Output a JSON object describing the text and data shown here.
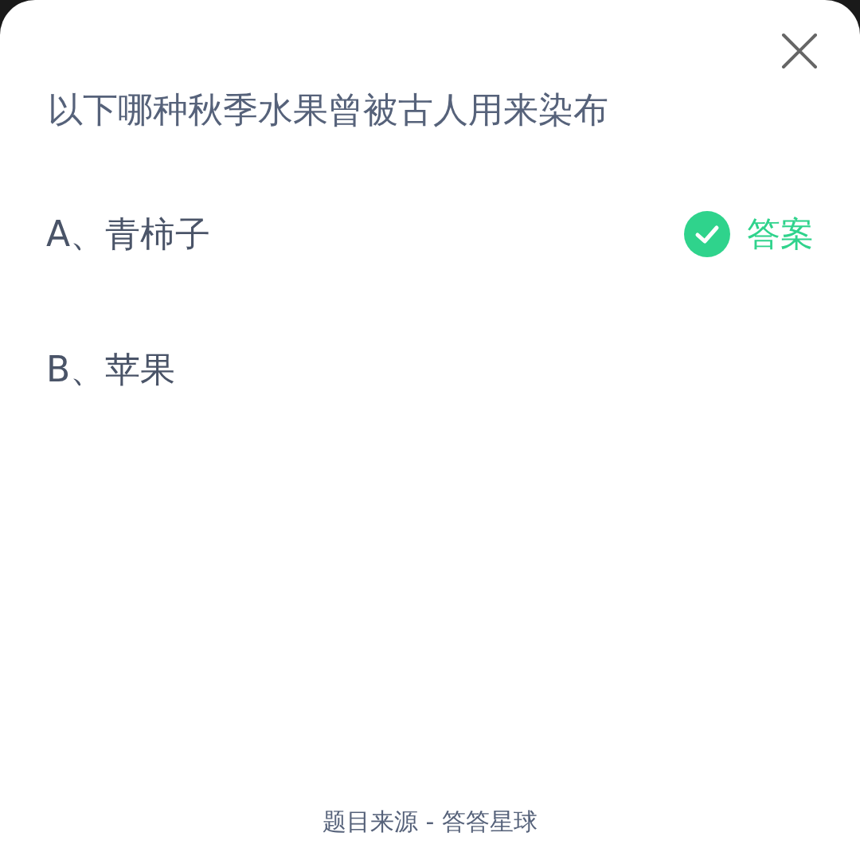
{
  "question": "以下哪种秋季水果曾被古人用来染布",
  "options": [
    {
      "text": "A、青柿子",
      "correct": true,
      "badge": "答案"
    },
    {
      "text": "B、苹果",
      "correct": false
    }
  ],
  "footer": "题目来源 - 答答星球"
}
